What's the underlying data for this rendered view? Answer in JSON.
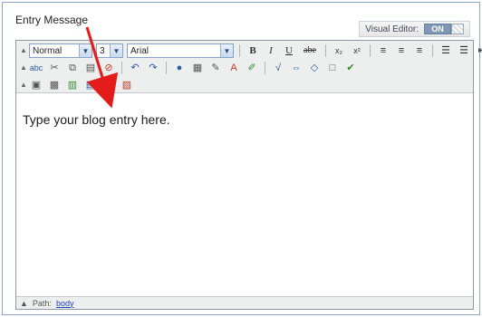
{
  "title": "Entry Message",
  "visual_editor": {
    "label": "Visual Editor:",
    "state": "ON"
  },
  "toolbar": {
    "format_select": "Normal",
    "size_select": "3",
    "font_select": "Arial",
    "bold": "B",
    "italic": "I",
    "underline": "U",
    "strike": "abe",
    "subscript": "x₂",
    "superscript": "x²",
    "spellcheck": "abc"
  },
  "editor": {
    "placeholder_text": "Type your blog entry here."
  },
  "statusbar": {
    "path_label": "Path:",
    "path_value": "body"
  },
  "annotation": {
    "arrow_color": "#e31b1b"
  },
  "colors": {
    "frame_border": "#8fa7c6",
    "toolbar_bg": "#ecefed",
    "toggle_on": "#7f96b5"
  }
}
